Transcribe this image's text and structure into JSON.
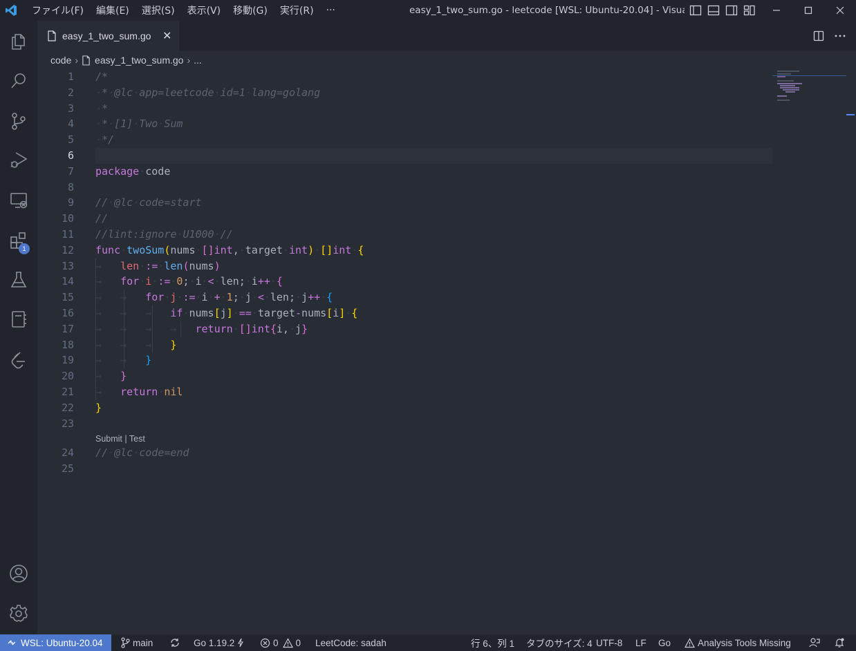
{
  "window": {
    "title": "easy_1_two_sum.go - leetcode [WSL: Ubuntu-20.04] - Visual ...",
    "menu": [
      "ファイル(F)",
      "編集(E)",
      "選択(S)",
      "表示(V)",
      "移動(G)",
      "実行(R)",
      "···"
    ]
  },
  "activity_bar": {
    "items": [
      "explorer-icon",
      "search-icon",
      "source-control-icon",
      "run-debug-icon",
      "remote-explorer-icon",
      "extensions-icon",
      "testing-icon",
      "notebook-icon",
      "leetcode-icon"
    ],
    "extensions_badge": "1",
    "bottom": [
      "account-icon",
      "settings-gear-icon"
    ]
  },
  "tab": {
    "label": "easy_1_two_sum.go",
    "close": "✕"
  },
  "breadcrumb": {
    "folder": "code",
    "file": "easy_1_two_sum.go",
    "more": "..."
  },
  "editor": {
    "line_numbers": [
      "1",
      "2",
      "3",
      "4",
      "5",
      "6",
      "7",
      "8",
      "9",
      "10",
      "11",
      "12",
      "13",
      "14",
      "15",
      "16",
      "17",
      "18",
      "19",
      "20",
      "21",
      "22",
      "23",
      "24",
      "25"
    ],
    "active_line": "6",
    "codelens": {
      "submit": "Submit",
      "separator": "|",
      "test": "Test"
    }
  },
  "statusbar": {
    "remote": "WSL: Ubuntu-20.04",
    "branch": "main",
    "go_version": "Go 1.19.2",
    "errors": "0",
    "warnings": "0",
    "leetcode_user": "LeetCode: sadah",
    "position": "行 6、列 1",
    "tab_size": "タブのサイズ: 4",
    "encoding": "UTF-8",
    "eol": "LF",
    "language": "Go",
    "analysis": "Analysis Tools Missing"
  },
  "colors": {
    "accent": "#4d78cc",
    "background": "#282c34",
    "chrome": "#21252b"
  }
}
